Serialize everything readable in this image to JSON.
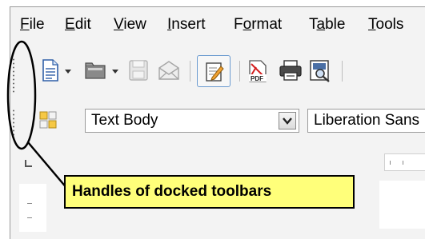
{
  "menubar": {
    "items": [
      {
        "label": "File",
        "mnemonic": "F"
      },
      {
        "label": "Edit",
        "mnemonic": "E"
      },
      {
        "label": "View",
        "mnemonic": "V"
      },
      {
        "label": "Insert",
        "mnemonic": "I"
      },
      {
        "label": "Format",
        "mnemonic": "o"
      },
      {
        "label": "Table",
        "mnemonic": "a"
      },
      {
        "label": "Tools",
        "mnemonic": "T"
      }
    ]
  },
  "toolbar": {
    "icons": [
      "new-document-icon",
      "open-folder-icon",
      "save-icon",
      "email-icon",
      "edit-file-icon",
      "export-pdf-icon",
      "print-icon",
      "print-preview-icon"
    ],
    "pdf_badge": "PDF"
  },
  "format_toolbar": {
    "style_value": "Text Body",
    "font_value": "Liberation Sans"
  },
  "callout": {
    "text": "Handles of docked toolbars"
  },
  "colors": {
    "callout_background": "#ffff7a",
    "active_button_border": "#6b9bd0"
  }
}
